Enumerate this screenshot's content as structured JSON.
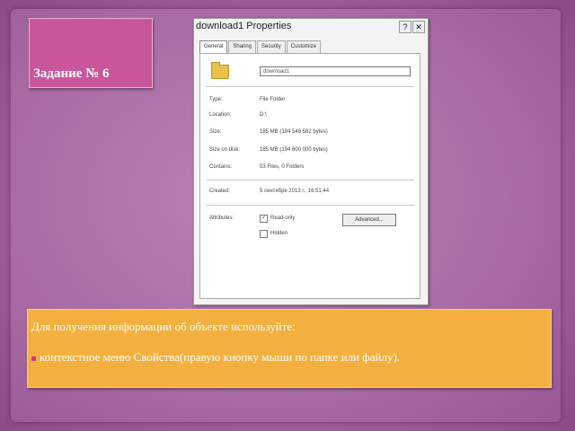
{
  "slide": {
    "title": "Задание № 6"
  },
  "dialog": {
    "title": "download1 Properties",
    "help_button": "?",
    "close_button": "✕",
    "tabs": [
      "General",
      "Sharing",
      "Security",
      "Customize"
    ],
    "name_value": "download1",
    "rows": [
      {
        "label": "Type:",
        "value": "File Folder"
      },
      {
        "label": "Location:",
        "value": "D:\\"
      },
      {
        "label": "Size:",
        "value": "185 MB (194 548 582 bytes)"
      },
      {
        "label": "Size on disk:",
        "value": "185 MB (194 600 000 bytes)"
      },
      {
        "label": "Contains:",
        "value": "53 Files, 0 Folders"
      },
      {
        "label": "Created:",
        "value": "5 сентября 2013 г., 16:51:44"
      }
    ],
    "attributes_label": "Attributes:",
    "read_only_label": "Read-only",
    "hidden_label": "Hidden",
    "advanced_button": "Advanced..."
  },
  "info": {
    "line1": "Для получения информации об объекте используйте:",
    "line2": "контекстное меню Свойства(правую кнопку мыши по папке или файлу)."
  },
  "colors": {
    "title_box": "#c9569b",
    "info_box": "#f4b03e",
    "bullet": "#c83a8c"
  }
}
